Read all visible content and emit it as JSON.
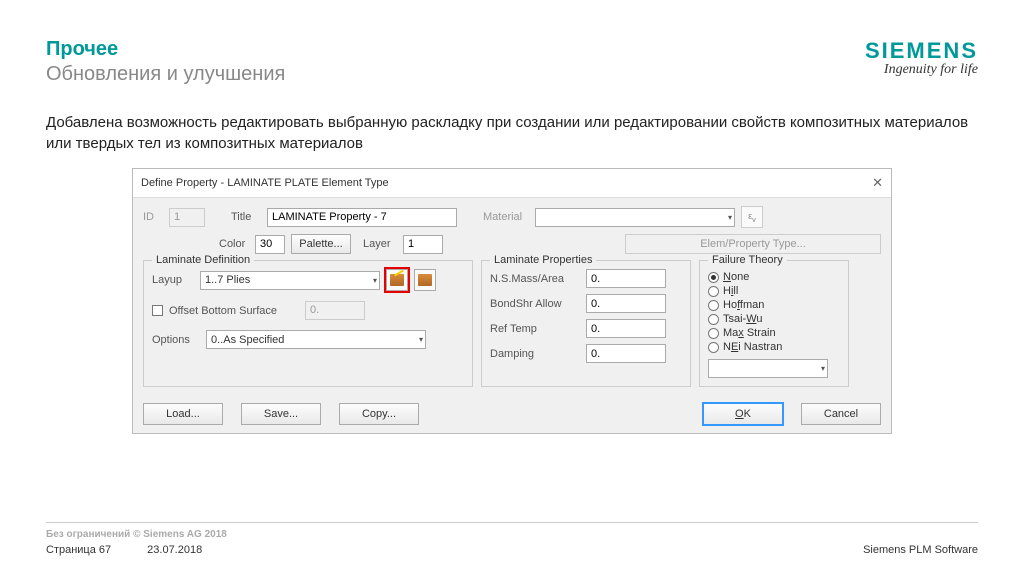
{
  "header": {
    "title": "Прочее",
    "subtitle": "Обновления и улучшения",
    "logo": "SIEMENS",
    "tagline": "Ingenuity for life"
  },
  "body_text": "Добавлена возможность редактировать выбранную раскладку при создании или редактировании свойств композитных материалов или твердых тел из композитных материалов",
  "dialog": {
    "title": "Define Property - LAMINATE PLATE Element Type",
    "close": "✕",
    "id_label": "ID",
    "id_value": "1",
    "title_label": "Title",
    "title_value": "LAMINATE Property - 7",
    "material_label": "Material",
    "color_label": "Color",
    "color_value": "30",
    "palette_btn": "Palette...",
    "layer_label": "Layer",
    "layer_value": "1",
    "elemtype_btn": "Elem/Property Type...",
    "lamdef": {
      "legend": "Laminate Definition",
      "layup_label": "Layup",
      "layup_value": "1..7 Plies",
      "offset_label": "Offset Bottom Surface",
      "offset_value": "0.",
      "options_label": "Options",
      "options_value": "0..As Specified"
    },
    "lamprops": {
      "legend": "Laminate Properties",
      "mass_label": "N.S.Mass/Area",
      "mass_value": "0.",
      "bond_label": "BondShr Allow",
      "bond_value": "0.",
      "reftemp_label": "Ref Temp",
      "reftemp_value": "0.",
      "damping_label": "Damping",
      "damping_value": "0."
    },
    "failure": {
      "legend": "Failure Theory",
      "none": "None",
      "hill": "Hill",
      "hoffman": "Hoffman",
      "tsaiwu": "Tsai-Wu",
      "maxstrain": "Max Strain",
      "nei": "NEi Nastran"
    },
    "buttons": {
      "load": "Load...",
      "save": "Save...",
      "copy": "Copy...",
      "ok": "OK",
      "cancel": "Cancel"
    }
  },
  "footer": {
    "restricted": "Без ограничений © Siemens AG 2018",
    "page": "Страница 67",
    "date": "23.07.2018",
    "brand": "Siemens PLM Software"
  }
}
